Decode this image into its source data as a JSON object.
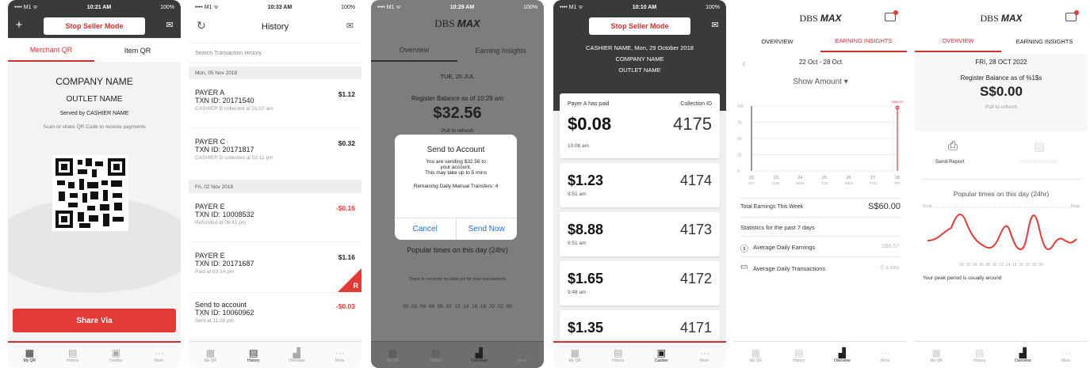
{
  "colors": {
    "accent": "#e53935",
    "dark": "#3a3a3a",
    "link": "#1e6fd0"
  },
  "phone1": {
    "status": {
      "carrier": "•••• M1 ᯤ",
      "time": "10:21 AM",
      "battery": "100%"
    },
    "seller_mode": "Stop Seller Mode",
    "tabs": [
      "Merchant QR",
      "Item QR"
    ],
    "company": "COMPANY NAME",
    "outlet": "OUTLET NAME",
    "served_by": "Served by CASHIER NAME",
    "scan_hint": "Scan or share QR Code to receive payments",
    "share_button": "Share Via",
    "nav": [
      "My QR",
      "History",
      "Cashier",
      "More"
    ]
  },
  "phone2": {
    "status": {
      "carrier": "•••• M1 ᯤ",
      "time": "10:33 AM",
      "battery": "100%"
    },
    "title": "History",
    "search_placeholder": "Search Transaction History",
    "sections": [
      "Mon, 05 Nov 2018",
      "Fri, 02 Nov 2018"
    ],
    "transactions": [
      {
        "payer": "PAYER A",
        "txn": "TXN ID: 20171540",
        "note": "CASHIER B collected at 01:02 am",
        "amount": "$1.12"
      },
      {
        "payer": "PAYER C",
        "txn": "TXN ID: 20171817",
        "note": "CASHIER D collected at 02:11 pm",
        "amount": "$0.32"
      },
      {
        "payer": "PAYER E",
        "txn": "TXN ID: 10008532",
        "note": "Refunded at 06:41 pm",
        "amount": "-$0.16"
      },
      {
        "payer": "PAYER E",
        "txn": "TXN ID: 20171687",
        "note": "Paid at 03:14 pm",
        "amount": "$1.16"
      },
      {
        "payer": "Send to account",
        "txn": "TXN ID: 10060962",
        "note": "Sent at 11:26 pm",
        "amount": "-$0.03"
      }
    ],
    "refund_badge": "R",
    "nav": [
      "My QR",
      "History",
      "Overview",
      "More"
    ]
  },
  "phone3": {
    "status": {
      "carrier": "•••• M1 ᯤ",
      "time": "10:29 AM",
      "battery": "100%"
    },
    "brand_a": "DBS",
    "brand_b": "MAX",
    "tabs": [
      "Overview",
      "Earning Insights"
    ],
    "date": "TUE, 25 JUL",
    "balance_label": "Register Balance as of 10:29 am",
    "balance": "$32.56",
    "pull": "Pull to refresh",
    "dialog": {
      "title": "Send to Account",
      "line1": "You are sending $32.56 to",
      "line2": "your account.",
      "line3": "This may take up to 5 mins",
      "remaining": "Remaining Daily Manual Transfers: 4",
      "cancel": "Cancel",
      "send": "Send Now"
    },
    "popular": "Popular times on this day (24hr)",
    "no_data": "There is currently no data yet for your transactions",
    "hours": "00  02  04  06  08  10  12  14  16  18  20  22  00",
    "nav": [
      "My QR",
      "History",
      "Overview",
      "More"
    ]
  },
  "phone4": {
    "status": {
      "carrier": "•••• M1 ᯤ",
      "time": "10:10 AM",
      "battery": "100%"
    },
    "seller_mode": "Stop Seller Mode",
    "header1": "CASHIER NAME, Mon, 29 October 2018",
    "header2": "COMPANY NAME",
    "header3": "OUTLET NAME",
    "first_label": "Payer A has paid",
    "collection": "Collection ID",
    "payments": [
      {
        "amount": "$0.08",
        "id": "4175",
        "time": "10:06 am"
      },
      {
        "amount": "$1.23",
        "id": "4174",
        "time": "9:51 am"
      },
      {
        "amount": "$8.88",
        "id": "4173",
        "time": "9:51 am"
      },
      {
        "amount": "$1.65",
        "id": "4172",
        "time": "9:48 am"
      },
      {
        "amount": "$1.35",
        "id": "4171",
        "time": ""
      }
    ],
    "nav": [
      "My QR",
      "History",
      "Cashier",
      "More"
    ]
  },
  "phone5": {
    "brand_a": "DBS",
    "brand_b": "MAX",
    "tabs": [
      "OVERVIEW",
      "EARNING INSIGHTS"
    ],
    "range": "22 Oct - 28 Oct",
    "show_amount": "Show Amount",
    "y_ticks": [
      "100",
      "75",
      "50",
      "25",
      "0"
    ],
    "days": [
      {
        "d": "22",
        "w": "SAT"
      },
      {
        "d": "23",
        "w": "SUN"
      },
      {
        "d": "24",
        "w": "MON"
      },
      {
        "d": "25",
        "w": "TUE"
      },
      {
        "d": "26",
        "w": "WED"
      },
      {
        "d": "27",
        "w": "THU"
      },
      {
        "d": "28",
        "w": "FRI"
      }
    ],
    "peak_tag": "S$60.00",
    "total_label": "Total Earnings This Week",
    "total": "S$60.00",
    "stats_title": "Statistics for the past 7 days",
    "avg_earn_label": "Average Daily Earnings",
    "avg_earn": "S$8.57",
    "avg_txn_label": "Average Daily Transactions",
    "avg_txn": "0 a day",
    "nav": [
      "My QR",
      "History",
      "Overview",
      "More"
    ]
  },
  "phone6": {
    "brand_a": "DBS",
    "brand_b": "MAX",
    "tabs": [
      "OVERVIEW",
      "EARNING INSIGHTS"
    ],
    "date": "FRI, 28 OCT 2022",
    "balance_label": "Register Balance as of %1$s",
    "balance": "S$0.00",
    "pull": "Pull to refresh",
    "send_report": "Send Report",
    "send_account": "Send to Account",
    "popular": "Popular times on this day (24hr)",
    "peak_left": "Peak",
    "peak_right": "Peak",
    "hours": "00  02  04  06  08  10  12  14  16  18  20  22  00",
    "peak_note": "Your peak period is usually around",
    "nav": [
      "My QR",
      "History",
      "Overview",
      "More"
    ]
  }
}
